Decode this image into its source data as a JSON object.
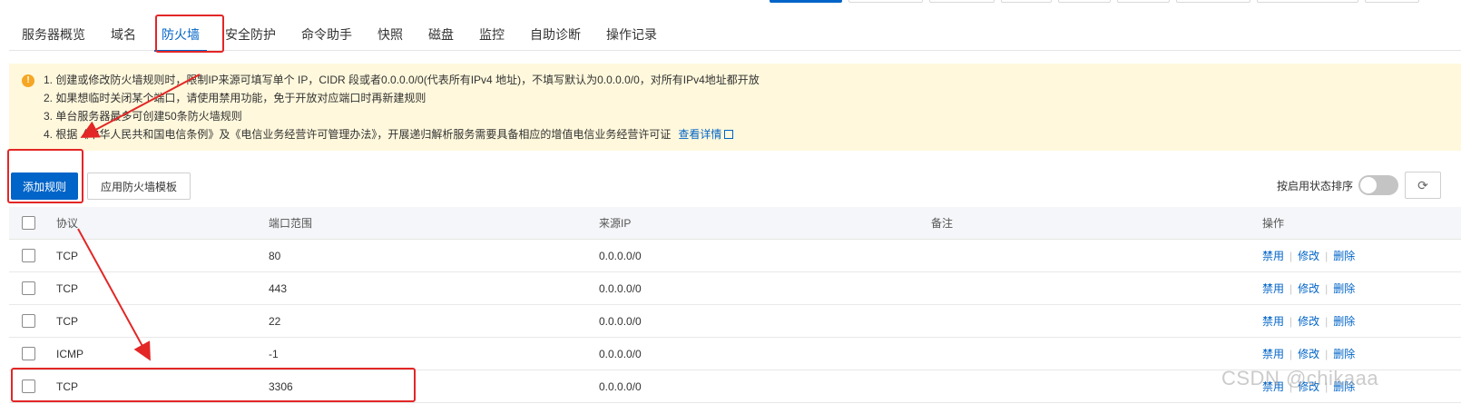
{
  "tabs": [
    "服务器概览",
    "域名",
    "防火墙",
    "安全防护",
    "命令助手",
    "快照",
    "磁盘",
    "监控",
    "自助诊断",
    "操作记录"
  ],
  "active_tab": "防火墙",
  "notice": {
    "lines": [
      "1. 创建或修改防火墙规则时，限制IP来源可填写单个 IP，CIDR 段或者0.0.0.0/0(代表所有IPv4 地址)，不填写默认为0.0.0.0/0，对所有IPv4地址都开放",
      "2. 如果想临时关闭某个端口，请使用禁用功能，免于开放对应端口时再新建规则",
      "3. 单台服务器最多可创建50条防火墙规则",
      "4. 根据《中华人民共和国电信条例》及《电信业务经营许可管理办法》，开展递归解析服务需要具备相应的增值电信业务经营许可证"
    ],
    "link_text": "查看详情"
  },
  "toolbar": {
    "add_label": "添加规则",
    "template_label": "应用防火墙模板",
    "sort_label": "按启用状态排序"
  },
  "table": {
    "headers": {
      "protocol": "协议",
      "port": "端口范围",
      "source": "来源IP",
      "note": "备注",
      "action": "操作"
    },
    "rows": [
      {
        "protocol": "TCP",
        "port": "80",
        "source": "0.0.0.0/0"
      },
      {
        "protocol": "TCP",
        "port": "443",
        "source": "0.0.0.0/0"
      },
      {
        "protocol": "TCP",
        "port": "22",
        "source": "0.0.0.0/0"
      },
      {
        "protocol": "ICMP",
        "port": "-1",
        "source": "0.0.0.0/0"
      },
      {
        "protocol": "TCP",
        "port": "3306",
        "source": "0.0.0.0/0"
      }
    ],
    "actions": {
      "disable": "禁用",
      "edit": "修改",
      "delete": "删除"
    }
  },
  "watermark": "CSDN @chikaaa",
  "icons": {
    "warning": "warning-icon",
    "external": "external-link-icon",
    "refresh": "refresh-icon"
  },
  "colors": {
    "primary": "#0064c8",
    "notice_bg": "#fff8dc",
    "annotation": "#e32626"
  }
}
